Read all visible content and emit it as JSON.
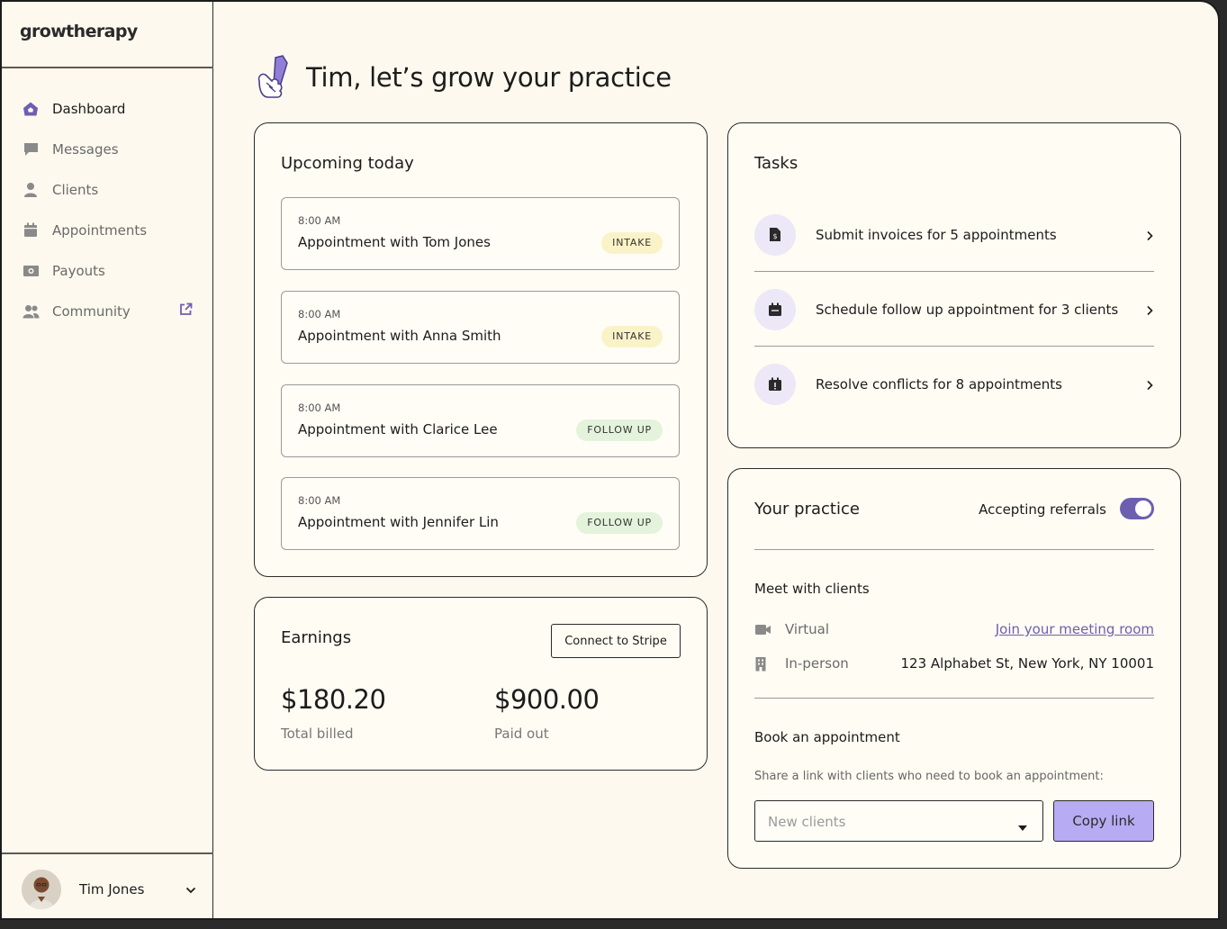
{
  "app": {
    "brand": "growtherapy"
  },
  "sidebar": {
    "items": [
      {
        "label": "Dashboard",
        "icon": "home-icon",
        "active": true
      },
      {
        "label": "Messages",
        "icon": "chat-bubble-icon"
      },
      {
        "label": "Clients",
        "icon": "person-icon"
      },
      {
        "label": "Appointments",
        "icon": "calendar-icon"
      },
      {
        "label": "Payouts",
        "icon": "cash-icon"
      },
      {
        "label": "Community",
        "icon": "people-icon",
        "external": true
      }
    ],
    "user": {
      "name": "Tim Jones"
    }
  },
  "greeting": "Tim, let’s grow your practice",
  "upcoming": {
    "title": "Upcoming today",
    "appointments": [
      {
        "time": "8:00 AM",
        "title": "Appointment with Tom Jones",
        "badge": "INTAKE",
        "kind": "intake"
      },
      {
        "time": "8:00 AM",
        "title": "Appointment with Anna Smith",
        "badge": "INTAKE",
        "kind": "intake"
      },
      {
        "time": "8:00 AM",
        "title": "Appointment with Clarice Lee",
        "badge": "FOLLOW UP",
        "kind": "follow"
      },
      {
        "time": "8:00 AM",
        "title": "Appointment with Jennifer Lin",
        "badge": "FOLLOW UP",
        "kind": "follow"
      }
    ]
  },
  "earnings": {
    "title": "Earnings",
    "stripe_label": "Connect to Stripe",
    "total": {
      "amount": "$180.20",
      "label": "Total billed"
    },
    "paid": {
      "amount": "$900.00",
      "label": "Paid out"
    }
  },
  "tasks": {
    "title": "Tasks",
    "items": [
      {
        "label": "Submit invoices for 5 appointments",
        "icon": "invoice-icon"
      },
      {
        "label": "Schedule follow up appointment for 3 clients",
        "icon": "calendar-add-icon"
      },
      {
        "label": "Resolve conflicts for 8 appointments",
        "icon": "calendar-alert-icon"
      }
    ]
  },
  "practice": {
    "title": "Your practice",
    "referrals_label": "Accepting referrals",
    "referrals_on": true,
    "meet": {
      "title": "Meet with clients",
      "virtual_label": "Virtual",
      "virtual_link": "Join your meeting room",
      "inperson_label": "In-person",
      "address": "123 Alphabet St, New York, NY 10001"
    },
    "book": {
      "title": "Book an appointment",
      "share_text": "Share a link with clients who need to book an appointment:",
      "select_value": "New clients",
      "copy_label": "Copy link"
    }
  },
  "colors": {
    "accent": "#6d5fb0",
    "accent_light": "#b7acf3",
    "background": "#fdf9ee",
    "intake_badge": "#fbf3c8",
    "follow_badge": "#e4f3dc"
  }
}
